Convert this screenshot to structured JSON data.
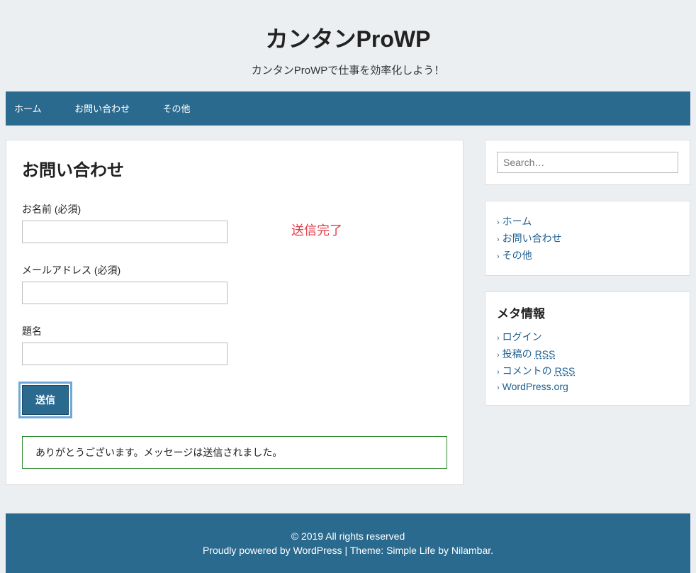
{
  "header": {
    "title": "カンタンProWP",
    "description": "カンタンProWPで仕事を効率化しよう！"
  },
  "nav": {
    "items": [
      "ホーム",
      "お問い合わせ",
      "その他"
    ]
  },
  "main": {
    "page_title": "お問い合わせ",
    "complete_text": "送信完了",
    "name_label": "お名前 (必須)",
    "email_label": "メールアドレス (必須)",
    "subject_label": "題名",
    "submit_label": "送信",
    "success_message": "ありがとうございます。メッセージは送信されました。"
  },
  "sidebar": {
    "search_placeholder": "Search…",
    "nav_links": [
      "ホーム",
      "お問い合わせ",
      "その他"
    ],
    "meta_title": "メタ情報",
    "meta_links": {
      "login": "ログイン",
      "posts_prefix": "投稿の ",
      "posts_rss": "RSS",
      "comments_prefix": "コメントの ",
      "comments_rss": "RSS",
      "wporg": "WordPress.org"
    }
  },
  "footer": {
    "copyright": "© 2019 All rights reserved",
    "powered_prefix": "Proudly powered by ",
    "powered_link": "WordPress",
    "theme_text": " | Theme: Simple Life by ",
    "theme_author": "Nilambar",
    "period": "."
  }
}
